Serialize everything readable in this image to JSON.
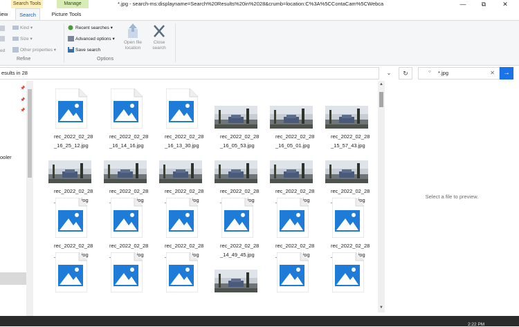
{
  "title_bar": {
    "contextual_tabs": [
      "Search Tools",
      "Manage"
    ],
    "window_title": "*.jpg - search-ms:displayname=Search%20Results%20in%2028&crumb=location:C%3A%5CContaCam%5CWebca",
    "controls": [
      "minimize",
      "restore",
      "close"
    ]
  },
  "ribbon_tabs": [
    "iew",
    "Search",
    "Picture Tools"
  ],
  "ribbon": {
    "refine": {
      "items": [
        "Kind",
        "Size",
        "Other properties"
      ],
      "partial_label": "ed",
      "label": "Refine"
    },
    "options": {
      "items": [
        "Recent searches",
        "Advanced options",
        "Save search"
      ],
      "open_file_location": [
        "Open file",
        "location"
      ],
      "close_search": [
        "Close",
        "search"
      ],
      "label": "Options"
    }
  },
  "address": {
    "text": "esults in 28",
    "search_value": "*.jpg"
  },
  "nav": {
    "partial_label": "ooler"
  },
  "files": [
    {
      "name": "rec_2022_02_28_16_25_12.jpg",
      "type": "generic"
    },
    {
      "name": "rec_2022_02_28_16_14_16.jpg",
      "type": "generic"
    },
    {
      "name": "rec_2022_02_28_16_13_30.jpg",
      "type": "generic"
    },
    {
      "name": "rec_2022_02_28_16_05_53.jpg",
      "type": "photo"
    },
    {
      "name": "rec_2022_02_28_16_05_01.jpg",
      "type": "photo"
    },
    {
      "name": "rec_2022_02_28_15_57_43.jpg",
      "type": "photo"
    },
    {
      "name": "rec_2022_02_28_15_21_13.jpg",
      "type": "photo"
    },
    {
      "name": "rec_2022_02_28_15_20_53.jpg",
      "type": "photo"
    },
    {
      "name": "rec_2022_02_28_15_20_44.jpg",
      "type": "photo"
    },
    {
      "name": "rec_2022_02_28_14_52_09.jpg",
      "type": "photo"
    },
    {
      "name": "rec_2022_02_28_14_51_33.jpg",
      "type": "photo"
    },
    {
      "name": "rec_2022_02_28_14_50_23.jpg",
      "type": "photo"
    },
    {
      "name": "rec_2022_02_28_14_50_08.jpg",
      "type": "generic"
    },
    {
      "name": "rec_2022_02_28_14_50_02.jpg",
      "type": "generic"
    },
    {
      "name": "rec_2022_02_28_14_49_56.jpg",
      "type": "generic"
    },
    {
      "name": "rec_2022_02_28_14_49_45.jpg",
      "type": "generic"
    },
    {
      "name": "rec_2022_02_28_14_49_15.jpg",
      "type": "generic"
    },
    {
      "name": "rec_2022_02_28_14_48_32.jpg",
      "type": "generic"
    },
    {
      "name": "",
      "type": "generic"
    },
    {
      "name": "",
      "type": "generic"
    },
    {
      "name": "",
      "type": "generic"
    },
    {
      "name": "",
      "type": "photo"
    },
    {
      "name": "",
      "type": "generic"
    },
    {
      "name": "",
      "type": "generic"
    }
  ],
  "preview": {
    "message": "Select a file to preview."
  },
  "taskbar": {
    "clock": "2:22 PM"
  },
  "colors": {
    "accent": "#1a73e8",
    "image_icon_blue": "#1e7bd8",
    "search_tools_tab": "#fdf0bf",
    "manage_tab": "#d8ecb5"
  }
}
